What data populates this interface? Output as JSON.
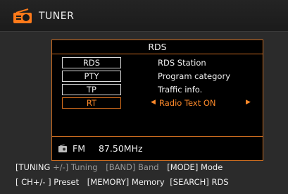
{
  "header": {
    "title": "TUNER",
    "icon": "radio-icon"
  },
  "panel": {
    "title": "RDS",
    "rows": [
      {
        "key": "RDS",
        "desc": "RDS Station",
        "selected": false
      },
      {
        "key": "PTY",
        "desc": "Program category",
        "selected": false
      },
      {
        "key": "TP",
        "desc": "Traffic info.",
        "selected": false
      },
      {
        "key": "RT",
        "desc": "Radio Text ON",
        "selected": true
      }
    ],
    "status": {
      "band": "FM",
      "frequency": "87.50MHz",
      "icon": "fm-icon"
    }
  },
  "footer": {
    "line1": {
      "tuning": "[TUNING",
      "tuning_rest": "+/-] Tuning",
      "band": "[BAND] Band",
      "mode": "[MODE] Mode"
    },
    "line2": {
      "ch": "[ CH+/-  ] Preset",
      "memory": "[MEMORY] Memory",
      "search": "[SEARCH] RDS"
    }
  },
  "colors": {
    "accent": "#d86f1d",
    "background": "#000000",
    "text": "#f0f0f0"
  }
}
